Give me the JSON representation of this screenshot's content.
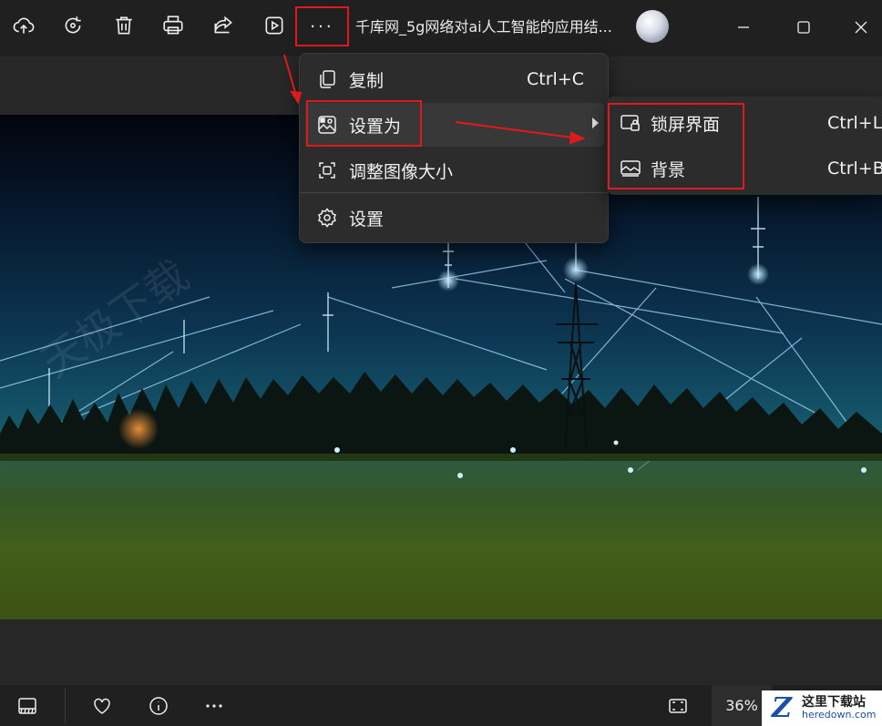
{
  "toolbar": {
    "buttons": [
      {
        "name": "cloud-upload-icon",
        "tooltip": ""
      },
      {
        "name": "rotate-icon",
        "tooltip": ""
      },
      {
        "name": "delete-icon",
        "tooltip": ""
      },
      {
        "name": "print-icon",
        "tooltip": ""
      },
      {
        "name": "share-icon",
        "tooltip": ""
      },
      {
        "name": "slideshow-icon",
        "tooltip": ""
      }
    ],
    "more_label": "···",
    "title": "千库网_5g网络对ai人工智能的应用结..."
  },
  "context_menu": {
    "items": [
      {
        "label": "复制",
        "shortcut": "Ctrl+C",
        "icon": "copy-icon"
      },
      {
        "label": "设置为",
        "shortcut": "",
        "icon": "set-as-image-icon",
        "has_submenu": true
      },
      {
        "label": "调整图像大小",
        "shortcut": "",
        "icon": "resize-icon"
      },
      {
        "label": "设置",
        "shortcut": "",
        "icon": "gear-icon"
      }
    ]
  },
  "submenu": {
    "items": [
      {
        "label": "锁屏界面",
        "shortcut": "Ctrl+L",
        "icon": "lock-screen-icon"
      },
      {
        "label": "背景",
        "shortcut": "Ctrl+B",
        "icon": "wallpaper-icon"
      }
    ]
  },
  "bottombar": {
    "zoom": "36%"
  },
  "watermark": {
    "cn": "这里下载站",
    "en": "heredown.com",
    "logo_letter": "Z"
  },
  "colors": {
    "annotation": "#e0191d",
    "menu_bg": "#2c2c2c",
    "app_bg": "#202020"
  }
}
